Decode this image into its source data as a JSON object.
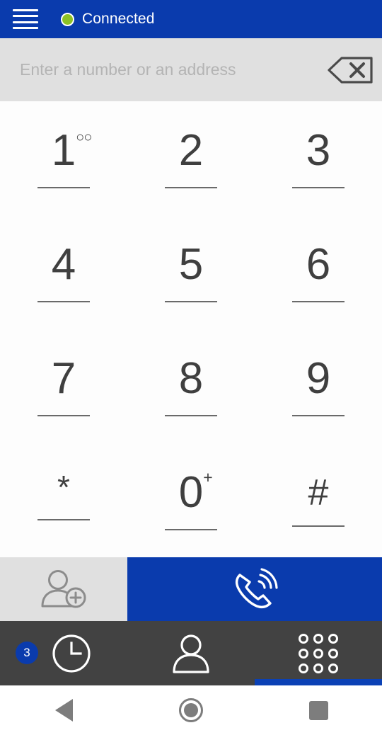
{
  "header": {
    "menu_icon": "hamburger-menu-icon",
    "status_dot_color": "#8dc225",
    "status_text": "Connected",
    "background_color": "#0a3bad"
  },
  "dial_input": {
    "value": "",
    "placeholder": "Enter a number or an address",
    "backspace_icon": "backspace-icon",
    "background_color": "#e0e0e0"
  },
  "keypad": {
    "keys": [
      {
        "glyph": "1",
        "sup": "∞",
        "sup_kind": "voicemail",
        "name": "key-1"
      },
      {
        "glyph": "2",
        "sup": "",
        "sup_kind": "none",
        "name": "key-2"
      },
      {
        "glyph": "3",
        "sup": "",
        "sup_kind": "none",
        "name": "key-3"
      },
      {
        "glyph": "4",
        "sup": "",
        "sup_kind": "none",
        "name": "key-4"
      },
      {
        "glyph": "5",
        "sup": "",
        "sup_kind": "none",
        "name": "key-5"
      },
      {
        "glyph": "6",
        "sup": "",
        "sup_kind": "none",
        "name": "key-6"
      },
      {
        "glyph": "7",
        "sup": "",
        "sup_kind": "none",
        "name": "key-7"
      },
      {
        "glyph": "8",
        "sup": "",
        "sup_kind": "none",
        "name": "key-8"
      },
      {
        "glyph": "9",
        "sup": "",
        "sup_kind": "none",
        "name": "key-9"
      },
      {
        "glyph": "*",
        "sup": "",
        "sup_kind": "none",
        "name": "key-star"
      },
      {
        "glyph": "0",
        "sup": "+",
        "sup_kind": "plus",
        "name": "key-0"
      },
      {
        "glyph": "#",
        "sup": "",
        "sup_kind": "none",
        "name": "key-hash"
      }
    ]
  },
  "actions": {
    "add_contact_icon": "add-contact-icon",
    "call_icon": "call-phone-icon",
    "call_button_color": "#0a3bad",
    "add_contact_background": "#e0e0e0"
  },
  "tabs": {
    "background_color": "#424242",
    "active_indicator_color": "#0b41b5",
    "items": [
      {
        "icon": "clock-recents-icon",
        "badge": "3",
        "active": false,
        "name": "tab-recents"
      },
      {
        "icon": "person-contacts-icon",
        "badge": "",
        "active": false,
        "name": "tab-contacts"
      },
      {
        "icon": "keypad-dots-icon",
        "badge": "",
        "active": true,
        "name": "tab-keypad"
      }
    ]
  },
  "system_nav": {
    "back_icon": "android-back-icon",
    "home_icon": "android-home-icon",
    "recents_icon": "android-recents-icon"
  }
}
